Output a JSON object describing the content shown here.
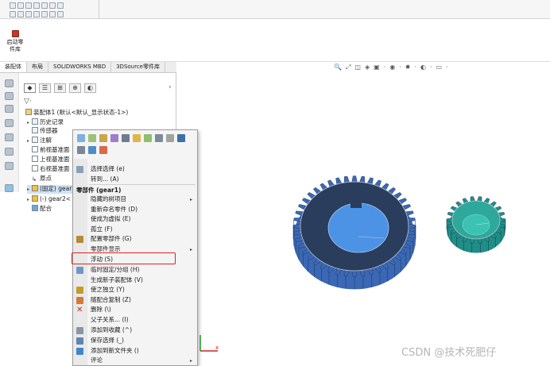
{
  "toolbox": {
    "label_line1": "启动零",
    "label_line2": "件库"
  },
  "tabs": [
    {
      "label": "装配体"
    },
    {
      "label": "布局"
    },
    {
      "label": "SOLIDWORKS MBD"
    },
    {
      "label": "3DSource零件库"
    }
  ],
  "panel": {
    "tab_glyphs": [
      "◆",
      "☰",
      "⊞",
      "⊕",
      "◐"
    ],
    "scroll_arrow": "›",
    "filter_glyph": "▽·",
    "tree": [
      {
        "label": "装配体1 (默认<默认_显示状态-1>)"
      },
      {
        "label": "历史记录"
      },
      {
        "label": "传感器"
      },
      {
        "label": "注解"
      },
      {
        "label": "前视基准面"
      },
      {
        "label": "上视基准面"
      },
      {
        "label": "右视基准面"
      },
      {
        "label": "原点"
      },
      {
        "label": "(固定) gear"
      },
      {
        "label": "(-) gear2<"
      },
      {
        "label": "配合"
      }
    ],
    "expand_glyph": "▸"
  },
  "heads_up_glyphs": [
    "🔍",
    "⤢",
    "◫",
    "◈",
    "▣",
    "·",
    "◉",
    "·",
    "✸",
    "·",
    "◐",
    "·",
    "▭",
    "·"
  ],
  "context_menu": {
    "items": [
      {
        "label": "选择选择 (e)"
      },
      {
        "label": "转到... (A)"
      },
      {
        "label": "零部件 (gear1)"
      },
      {
        "label": "隐藏的树项目"
      },
      {
        "label": "重新命名零件 (D)"
      },
      {
        "label": "使成为虚拟 (E)"
      },
      {
        "label": "孤立 (F)"
      },
      {
        "label": "配置零部件 (G)"
      },
      {
        "label": "零部件显示"
      },
      {
        "label": "浮动 (S)"
      },
      {
        "label": "临时固定/分组 (H)"
      },
      {
        "label": "生成新子装配体 (V)"
      },
      {
        "label": "使之独立 (Y)"
      },
      {
        "label": "随配合复制 (Z)"
      },
      {
        "label": "删除 (\\)"
      },
      {
        "label": "父子关系... (I)"
      },
      {
        "label": "添加到收藏 (^)"
      },
      {
        "label": "保存选择 (_)"
      },
      {
        "label": "添加到新文件夹 ()"
      },
      {
        "label": "评论"
      }
    ],
    "submenu_arrow": "▸"
  },
  "triad": {
    "x_label": "x"
  },
  "watermark": "CSDN @技术死肥仔",
  "colors": {
    "gear_large_top": "#2a3d5c",
    "gear_large_side": "#3b68b5",
    "gear_hub": "#4c93e6",
    "gear_small": "#2ea89a",
    "highlight": "#e02020"
  }
}
